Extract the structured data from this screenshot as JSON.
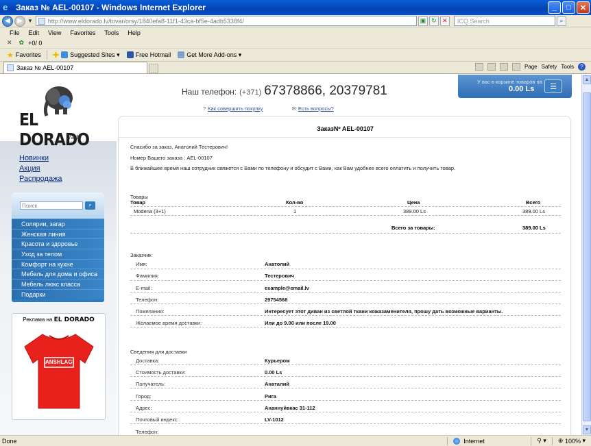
{
  "browser": {
    "window_title": "Заказ № AEL-00107 - Windows Internet Explorer",
    "url": "http://www.eldorado.lv/tovar/orsy/1840efa8-11f1-43ca-bf5e-4adb5338f4/",
    "search_placeholder": "ICQ Search",
    "menu": [
      "File",
      "Edit",
      "View",
      "Favorites",
      "Tools",
      "Help"
    ],
    "cmd_counter": "+0/ 0",
    "favorites_label": "Favorites",
    "fav_items": [
      "Suggested Sites",
      "Free Hotmail",
      "Get More Add-ons"
    ],
    "tab_title": "Заказ № AEL-00107",
    "tools": [
      "Page",
      "Safety",
      "Tools"
    ],
    "status_done": "Done",
    "status_zone": "Internet",
    "zoom": "100%"
  },
  "site": {
    "logo_text": "EL DORADO",
    "logo_sub": "Trade",
    "phone_label": "Наш телефон:",
    "phone_code": "(+371)",
    "phone_numbers": "67378866, 20379781",
    "help_link_1": "Как совершить покупку",
    "help_link_2": "Есть вопросы?",
    "cart_label": "У вас в корзине товаров на",
    "cart_sum": "0.00 Ls",
    "promo_links": [
      "Новинки",
      "Акция",
      "Распродажа"
    ],
    "search_placeholder": "Поиск",
    "categories": [
      "Солярии, загар",
      "Женская линия",
      "Красота и здоровье",
      "Уход за телом",
      "Комфорт на кухне",
      "Мебель для дома и офиса",
      "Мебель люкс класса",
      "Подарки"
    ],
    "ad_label": "Реклама на",
    "ad_logo": "EL DORADO",
    "shirt_text": "ANSHLAG!"
  },
  "order": {
    "title": "ЗаказNº AEL-00107",
    "thanks": "Спасибо за заказ, Анатолий Тестерович!",
    "order_number": "Номер Вашего заказа : AEL-00107",
    "notice": "В ближайшее время наш сотрудник свяжется с Вами по телефону и обсудит с Вами, как Вам удобнее всего оплатить и получить товар.",
    "goods_section": "Товары",
    "headers": {
      "product": "Товар",
      "qty": "Кол-во",
      "price": "Цена",
      "total": "Всего"
    },
    "items": [
      {
        "product": "Modena (3+1)",
        "qty": "1",
        "price": "389.00 Ls",
        "total": "389.00 Ls"
      }
    ],
    "grand_label": "Всего за товары:",
    "grand_value": "389.00 Ls",
    "customer_section": "Заказчик",
    "customer": [
      {
        "label": "Имя:",
        "value": "Анатолий"
      },
      {
        "label": "Фамилия:",
        "value": "Тестерович"
      },
      {
        "label": "E-mail:",
        "value": "example@email.lv"
      },
      {
        "label": "Телефон:",
        "value": "29754568"
      },
      {
        "label": "Пожелания:",
        "value": "Интересует этот диван из светлой ткани кожазаменителя, прошу дать возможные варианты."
      },
      {
        "label": "Желаемое время доставки:",
        "value": "Или до 9.00 или после 19.00"
      }
    ],
    "delivery_section": "Сведения для доставки",
    "delivery": [
      {
        "label": "Доставка:",
        "value": "Курьером"
      },
      {
        "label": "Стоимость доставки:",
        "value": "0.00 Ls"
      },
      {
        "label": "Получатель:",
        "value": "Анаталий"
      },
      {
        "label": "Город:",
        "value": "Рига"
      },
      {
        "label": "Адрес:",
        "value": "Ананнуйвкас 31-112"
      },
      {
        "label": "Почтовый индекс:",
        "value": "LV-1012"
      },
      {
        "label": "Телефон:",
        "value": ""
      }
    ]
  },
  "colors": {
    "accent": "#2f7bbf",
    "titlebar": "#0a5fd8",
    "shirt": "#e8211d"
  }
}
